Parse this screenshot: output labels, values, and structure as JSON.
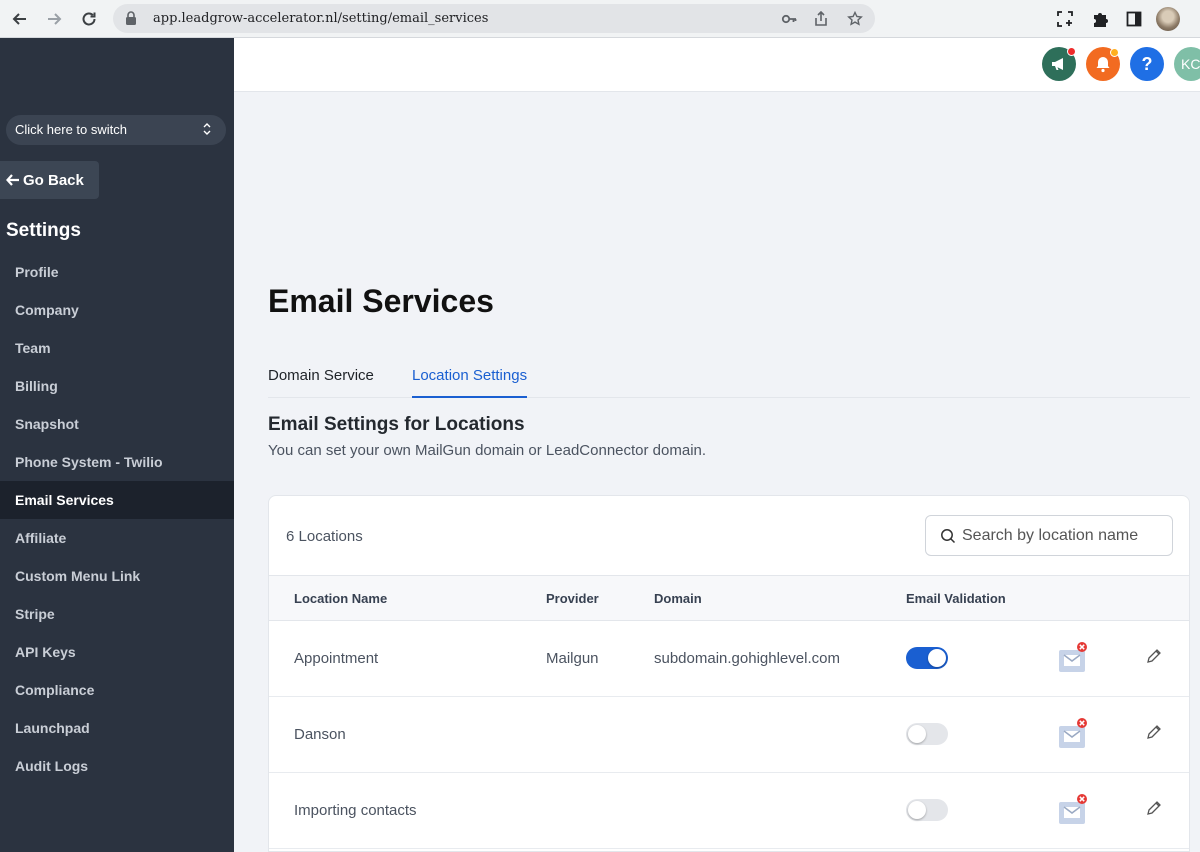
{
  "browser": {
    "url": "app.leadgrow-accelerator.nl/setting/email_services"
  },
  "sidebar": {
    "switcher_label": "Click here to switch",
    "go_back_label": "Go Back",
    "settings_title": "Settings",
    "items": [
      {
        "label": "Profile"
      },
      {
        "label": "Company"
      },
      {
        "label": "Team"
      },
      {
        "label": "Billing"
      },
      {
        "label": "Snapshot"
      },
      {
        "label": "Phone System - Twilio"
      },
      {
        "label": "Email Services",
        "active": true
      },
      {
        "label": "Affiliate"
      },
      {
        "label": "Custom Menu Link"
      },
      {
        "label": "Stripe"
      },
      {
        "label": "API Keys"
      },
      {
        "label": "Compliance"
      },
      {
        "label": "Launchpad"
      },
      {
        "label": "Audit Logs"
      }
    ]
  },
  "header": {
    "help_label": "?",
    "avatar_initials": "KC",
    "colors": {
      "announce": "#2e6f5a",
      "bell": "#f26b21",
      "help": "#1f6fe5",
      "avatar": "#7fbfa7"
    }
  },
  "main": {
    "title": "Email Services",
    "tabs": [
      {
        "label": "Domain Service",
        "active": false
      },
      {
        "label": "Location Settings",
        "active": true
      }
    ],
    "section_title": "Email Settings for Locations",
    "section_subtitle": "You can set your own MailGun domain or LeadConnector domain.",
    "count_label": "6 Locations",
    "search_placeholder": "Search by location name",
    "columns": {
      "name": "Location Name",
      "provider": "Provider",
      "domain": "Domain",
      "validation": "Email Validation"
    },
    "rows": [
      {
        "name": "Appointment",
        "provider": "Mailgun",
        "domain": "subdomain.gohighlevel.com",
        "validation": true
      },
      {
        "name": "Danson",
        "provider": "",
        "domain": "",
        "validation": false
      },
      {
        "name": "Importing contacts",
        "provider": "",
        "domain": "",
        "validation": false
      }
    ]
  },
  "colors": {
    "sidebar_bg": "#2b3340",
    "accent": "#1a5fd1",
    "page_bg": "#f1f3f7"
  }
}
